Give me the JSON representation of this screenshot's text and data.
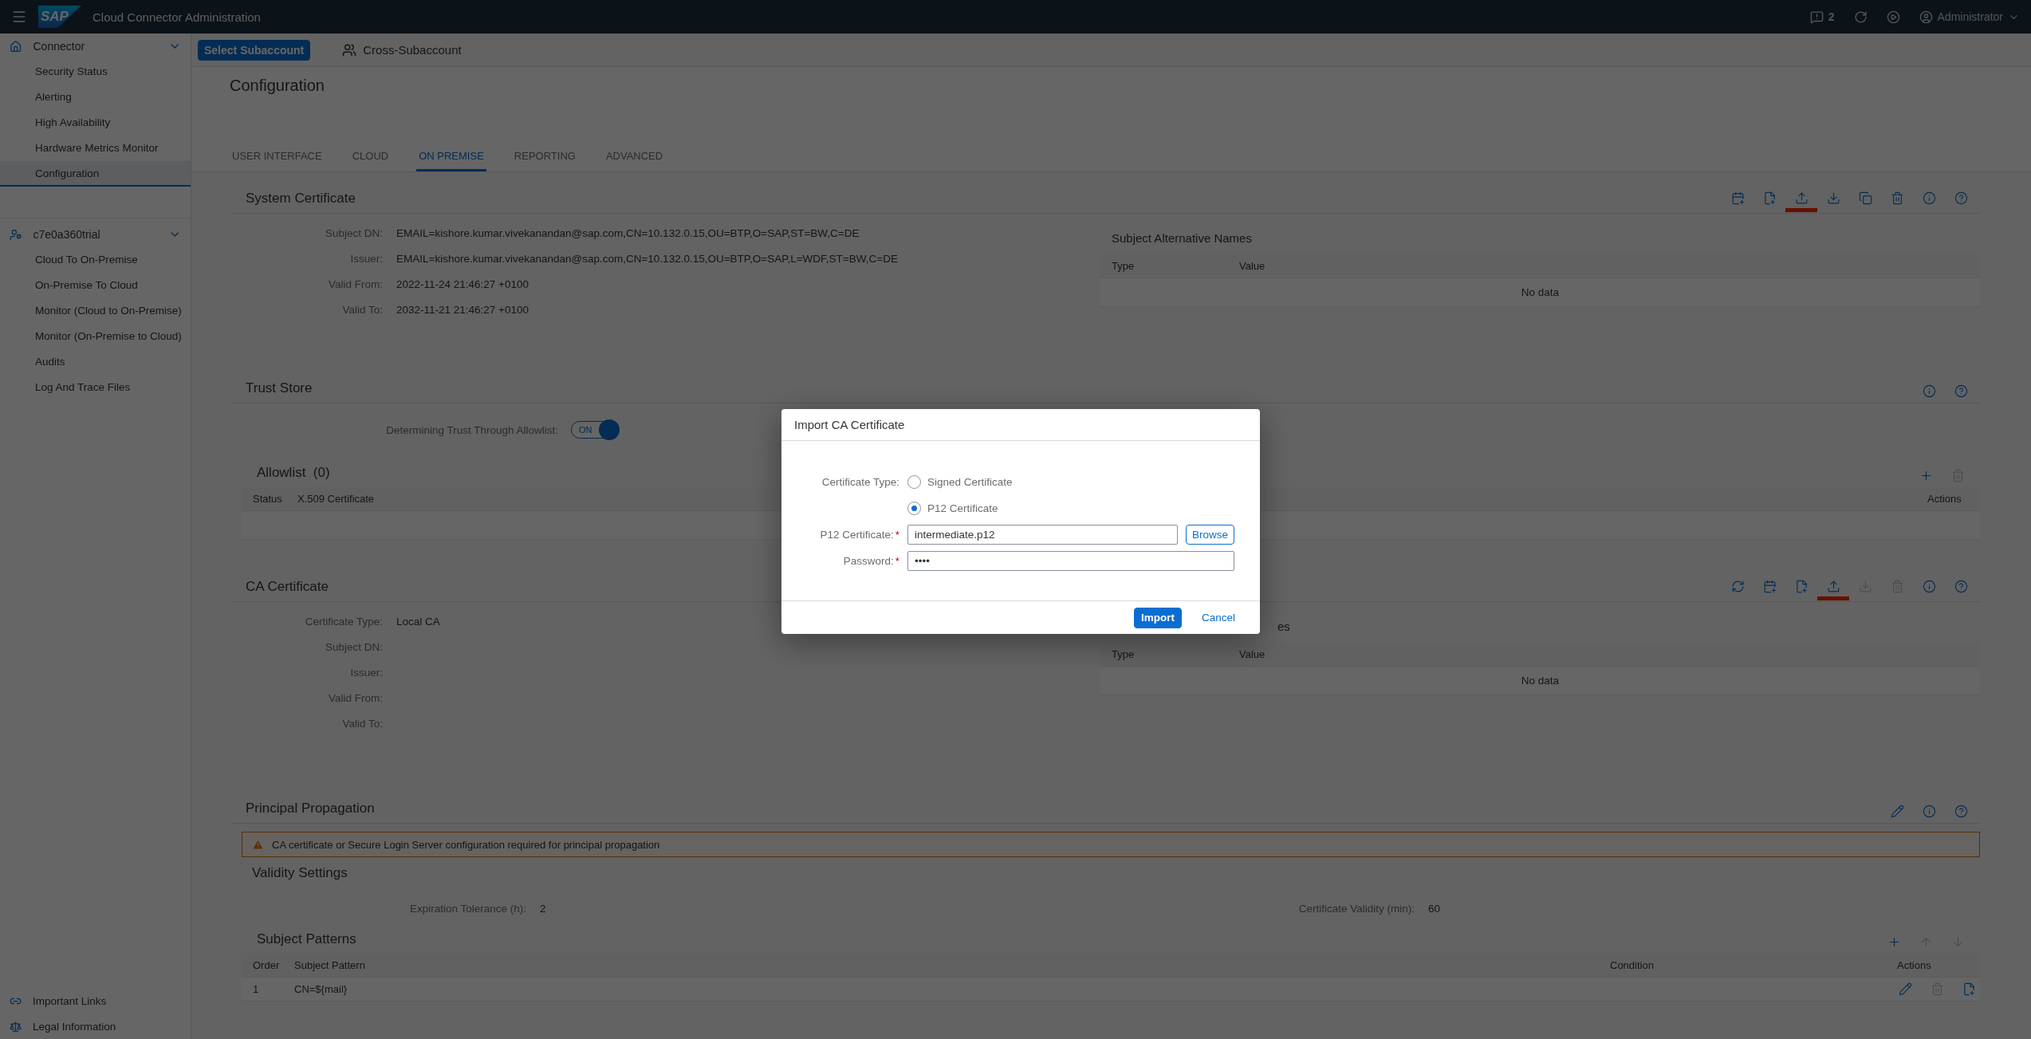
{
  "header": {
    "logo": "SAP",
    "title": "Cloud Connector Administration",
    "notifications": "2",
    "user": "Administrator"
  },
  "sidebar": {
    "groups": [
      {
        "label": "Connector",
        "kind": "home",
        "expanded": true,
        "items": [
          {
            "label": "Security Status",
            "selected": false
          },
          {
            "label": "Alerting",
            "selected": false
          },
          {
            "label": "High Availability",
            "selected": false
          },
          {
            "label": "Hardware Metrics Monitor",
            "selected": false
          },
          {
            "label": "Configuration",
            "selected": true
          }
        ]
      },
      {
        "label": "c7e0a360trial",
        "kind": "account",
        "expanded": true,
        "items": [
          {
            "label": "Cloud To On-Premise",
            "selected": false
          },
          {
            "label": "On-Premise To Cloud",
            "selected": false
          },
          {
            "label": "Monitor (Cloud to On-Premise)",
            "selected": false
          },
          {
            "label": "Monitor (On-Premise to Cloud)",
            "selected": false
          },
          {
            "label": "Audits",
            "selected": false
          },
          {
            "label": "Log And Trace Files",
            "selected": false
          }
        ]
      }
    ],
    "footer_links": [
      {
        "label": "Important Links",
        "kind": "link"
      },
      {
        "label": "Legal Information",
        "kind": "legal"
      }
    ]
  },
  "subbar": {
    "button": "Select Subaccount",
    "link": "Cross-Subaccount"
  },
  "page_title": "Configuration",
  "tabs": [
    {
      "label": "USER INTERFACE",
      "selected": false
    },
    {
      "label": "CLOUD",
      "selected": false
    },
    {
      "label": "ON PREMISE",
      "selected": true
    },
    {
      "label": "REPORTING",
      "selected": false
    },
    {
      "label": "ADVANCED",
      "selected": false
    }
  ],
  "system_certificate": {
    "title": "System Certificate",
    "toolbar": [
      {
        "kind": "calendar",
        "disabled": false
      },
      {
        "kind": "file",
        "disabled": false
      },
      {
        "kind": "upload",
        "disabled": false,
        "marked": true
      },
      {
        "kind": "download",
        "disabled": false
      },
      {
        "kind": "copy",
        "disabled": false
      },
      {
        "kind": "delete",
        "disabled": false
      },
      {
        "kind": "info",
        "disabled": false
      },
      {
        "kind": "help",
        "disabled": false
      }
    ],
    "fields": [
      {
        "label": "Subject DN:",
        "value": "EMAIL=kishore.kumar.vivekanandan@sap.com,CN=10.132.0.15,OU=BTP,O=SAP,ST=BW,C=DE"
      },
      {
        "label": "Issuer:",
        "value": "EMAIL=kishore.kumar.vivekanandan@sap.com,CN=10.132.0.15,OU=BTP,O=SAP,L=WDF,ST=BW,C=DE"
      },
      {
        "label": "Valid From:",
        "value": "2022-11-24 21:46:27 +0100"
      },
      {
        "label": "Valid To:",
        "value": "2032-11-21 21:46:27 +0100"
      }
    ],
    "san": {
      "title": "Subject Alternative Names",
      "columns": [
        "Type",
        "Value"
      ],
      "empty": "No data"
    }
  },
  "trust_store": {
    "title": "Trust Store",
    "toolbar": [
      {
        "kind": "info",
        "disabled": false
      },
      {
        "kind": "help",
        "disabled": false
      }
    ],
    "toggle": {
      "label": "Determining Trust Through Allowlist:",
      "on": true,
      "text": "ON"
    },
    "allowlist": {
      "title": "Allowlist  (0)",
      "toolbar": [
        {
          "kind": "plus",
          "disabled": false
        },
        {
          "kind": "delete",
          "disabled": true
        }
      ],
      "columns": [
        "Status",
        "X.509 Certificate",
        "Actions"
      ]
    }
  },
  "ca_certificate": {
    "title": "CA Certificate",
    "toolbar": [
      {
        "kind": "refresh",
        "disabled": false
      },
      {
        "kind": "calendar",
        "disabled": false
      },
      {
        "kind": "file",
        "disabled": false
      },
      {
        "kind": "upload",
        "disabled": false,
        "marked": true
      },
      {
        "kind": "download",
        "disabled": true
      },
      {
        "kind": "delete",
        "disabled": true
      },
      {
        "kind": "info",
        "disabled": false
      },
      {
        "kind": "help",
        "disabled": false
      }
    ],
    "fields": [
      {
        "label": "Certificate Type:",
        "value": "Local CA"
      },
      {
        "label": "Subject DN:"
      },
      {
        "label": "Issuer:"
      },
      {
        "label": "Valid From:"
      },
      {
        "label": "Valid To:"
      }
    ],
    "san": {
      "title": "es",
      "columns": [
        "Type",
        "Value"
      ],
      "empty": "No data"
    }
  },
  "principal_propagation": {
    "title": "Principal Propagation",
    "toolbar": [
      {
        "kind": "edit",
        "disabled": false
      },
      {
        "kind": "info",
        "disabled": false
      },
      {
        "kind": "help",
        "disabled": false
      }
    ],
    "warning": "CA certificate or Secure Login Server configuration required for principal propagation",
    "validity": {
      "title": "Validity Settings",
      "fields": [
        {
          "label": "Expiration Tolerance (h):",
          "value": "2"
        },
        {
          "label": "Certificate Validity (min):",
          "value": "60"
        }
      ]
    },
    "subject_patterns": {
      "title": "Subject Patterns",
      "toolbar": [
        {
          "kind": "plus",
          "disabled": false
        },
        {
          "kind": "up",
          "disabled": true
        },
        {
          "kind": "down",
          "disabled": true
        }
      ],
      "columns": [
        "Order",
        "Subject Pattern",
        "Condition",
        "Actions"
      ],
      "rows": [
        {
          "order": "1",
          "pattern": "CN=${mail}",
          "actions": [
            {
              "kind": "edit",
              "disabled": false
            },
            {
              "kind": "delete",
              "disabled": true
            },
            {
              "kind": "file",
              "disabled": false
            }
          ]
        }
      ]
    }
  },
  "dialog": {
    "title": "Import CA Certificate",
    "type_label": "Certificate Type:",
    "options": [
      {
        "label": "Signed Certificate",
        "selected": false
      },
      {
        "label": "P12 Certificate",
        "selected": true
      }
    ],
    "file": {
      "label": "P12 Certificate:",
      "required_mark": "*",
      "value": "intermediate.p12",
      "button": "Browse"
    },
    "password": {
      "label": "Password:",
      "required_mark": "*",
      "value": "••••"
    },
    "buttons": [
      {
        "label": "Import",
        "kind": "primary"
      },
      {
        "label": "Cancel",
        "kind": "link"
      }
    ]
  }
}
